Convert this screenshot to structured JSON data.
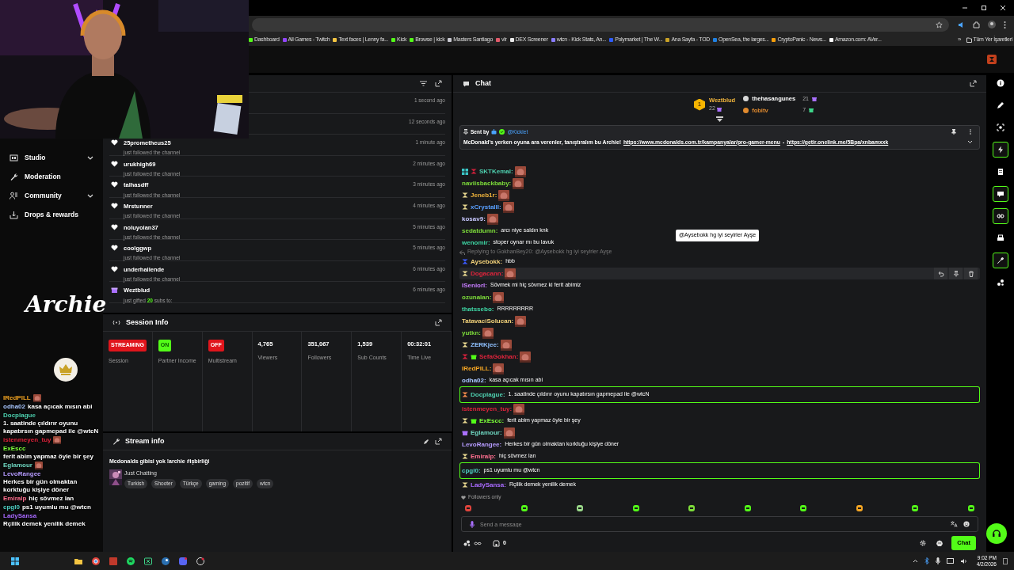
{
  "browser": {
    "bookmarks": [
      {
        "label": "Dashboard",
        "color": "#53fc18"
      },
      {
        "label": "All Games - Twitch",
        "color": "#9146ff"
      },
      {
        "label": "Text faces | Lenny fa...",
        "color": "#f5c542"
      },
      {
        "label": "Kick",
        "color": "#53fc18"
      },
      {
        "label": "Browse | kick",
        "color": "#53fc18"
      },
      {
        "label": "Masters Santiago",
        "color": "#c8c8d0"
      },
      {
        "label": "vlr",
        "color": "#e05a6a"
      },
      {
        "label": "DEX Screener",
        "color": "#e8e8e8"
      },
      {
        "label": "wtcn - Kick Stats, An...",
        "color": "#8a7dff"
      },
      {
        "label": "Polymarket | The W...",
        "color": "#2e5cff"
      },
      {
        "label": "Ana Sayfa - TOD",
        "color": "#c9a227"
      },
      {
        "label": "OpenSea, the larges...",
        "color": "#2081e2"
      },
      {
        "label": "CryptoPanic - News...",
        "color": "#f59e0b"
      },
      {
        "label": "Amazon.com: AVer...",
        "color": "#ffffff"
      }
    ],
    "more": "»",
    "all_bookmarks": "Tüm Yer İşaretleri"
  },
  "sidebar": {
    "items": [
      {
        "label": "Studio",
        "expandable": true
      },
      {
        "label": "Moderation",
        "expandable": false
      },
      {
        "label": "Community",
        "expandable": true
      },
      {
        "label": "Drops & rewards",
        "expandable": false
      }
    ]
  },
  "overlay": {
    "logo": "Archie",
    "chat": [
      {
        "user": "IRedPILL",
        "color": "#f5a623",
        "emote": true
      },
      {
        "user": "odha02",
        "color": "#a9c7ff",
        "text": "kasa açıcak mısın abi"
      },
      {
        "user": "Docplague",
        "color": "#4fd1b0",
        "text": "1. saatinde çıldırır oyunu kapatırsın gapmepad ile @wtcN"
      },
      {
        "user": "istenmeyen_tuy",
        "color": "#e0243c",
        "emote": true
      },
      {
        "user": "ExEscc",
        "color": "#7dff3a",
        "text": "ferit abim yapmaz öyle bir şey"
      },
      {
        "user": "Eglamour",
        "color": "#6fd6c0",
        "emote": true
      },
      {
        "user": "LevoRangee",
        "color": "#b69cff",
        "text": "Herkes bir gün olmaktan korktuğu kişiye döner"
      },
      {
        "user": "Emiralp",
        "color": "#ff6f8f",
        "text": "hiç sövmez lan"
      },
      {
        "user": "cpgl0",
        "color": "#4fd1c5",
        "text": "ps1 uyumlu mu @wtcn"
      },
      {
        "user": "LadySansa",
        "color": "#a96bff",
        "text": "Rçilik demek yenilik demek"
      }
    ]
  },
  "activity_feed": {
    "items": [
      {
        "kind": "hidden",
        "time": "1 second ago"
      },
      {
        "kind": "hidden",
        "time": "12 seconds ago"
      },
      {
        "kind": "follow",
        "user": "25prometheus25",
        "detail": "just followed the channel",
        "time": "1 minute ago"
      },
      {
        "kind": "follow",
        "user": "urukhigh69",
        "detail": "just followed the channel",
        "time": "2 minutes ago"
      },
      {
        "kind": "follow",
        "user": "talhasdff",
        "detail": "just followed the channel",
        "time": "3 minutes ago"
      },
      {
        "kind": "follow",
        "user": "Mrstunner",
        "detail": "just followed the channel",
        "time": "4 minutes ago"
      },
      {
        "kind": "follow",
        "user": "noluyolan37",
        "detail": "just followed the channel",
        "time": "5 minutes ago"
      },
      {
        "kind": "follow",
        "user": "coolggwp",
        "detail": "just followed the channel",
        "time": "5 minutes ago"
      },
      {
        "kind": "follow",
        "user": "underhallende",
        "detail": "just followed the channel",
        "time": "6 minutes ago"
      },
      {
        "kind": "gift",
        "user": "Weztblud",
        "detail": "just gifted",
        "gift_count": "20",
        "detail_end": "subs to:",
        "time": "6 minutes ago"
      }
    ]
  },
  "session_info": {
    "title": "Session Info",
    "stats": [
      {
        "kind": "badge",
        "value": "STREAMING",
        "color": "#e0151c",
        "label": "Session"
      },
      {
        "kind": "badge",
        "value": "ON",
        "color": "#53fc18",
        "label": "Partner Income"
      },
      {
        "kind": "badge",
        "value": "OFF",
        "color": "#e0151c",
        "label": "Multistream"
      },
      {
        "kind": "number",
        "value": "4,765",
        "label": "Viewers"
      },
      {
        "kind": "number",
        "value": "351,067",
        "label": "Followers"
      },
      {
        "kind": "number",
        "value": "1,539",
        "label": "Sub Counts"
      },
      {
        "kind": "number",
        "value": "00:32:01",
        "label": "Time Live"
      }
    ]
  },
  "stream_info": {
    "title": "Stream info",
    "stream_title": "Mcdonalds gibisi yok !archie #işbirliği",
    "category": "Just Chatting",
    "tags": [
      "Turkish",
      "Shooter",
      "Türkçe",
      "gaming",
      "pozitif",
      "wtcn"
    ]
  },
  "chat": {
    "title": "Chat",
    "leaderboard": [
      {
        "kind": "gold",
        "rank": "1",
        "user": "Weztblud",
        "count": "22"
      },
      {
        "kind": "silver",
        "user": "thehasangunes",
        "count": "21"
      },
      {
        "kind": "bronze",
        "user": "fobitv",
        "count": "7"
      }
    ],
    "pinned": {
      "label": "Sent by",
      "sender": "@Kicklet",
      "text": "McDonald's yerken oyuna ara verenler, tanıştıralım bu Archie!",
      "links": [
        "https://www.mcdonalds.com.tr/kampanyalar/pro-gamer-menu",
        "https://getir.onelink.me/5Bpa/xnbamxxk"
      ],
      "separator": "-"
    },
    "tooltip": "@Aysebokk hg iyi seyirler Ayşe",
    "messages": [
      {
        "user": "SKTKemal:",
        "color": "#4fd1b0",
        "badges": [
          {
            "kind": "grid",
            "color": "#3bc6c6"
          },
          {
            "kind": "sub",
            "color": "#d0213b"
          }
        ],
        "emote": true,
        "highlighted": false,
        "hovered": false
      },
      {
        "user": "naviisbackbaby:",
        "color": "#7ddc3a",
        "emote": true,
        "highlighted": false,
        "hovered": false
      },
      {
        "user": "Jeneb1r:",
        "color": "#f0b43c",
        "badges": [
          {
            "kind": "sub",
            "color": "#e8d890"
          }
        ],
        "emote": true,
        "highlighted": false,
        "hovered": false
      },
      {
        "user": "xCrystalll:",
        "color": "#5aa0ff",
        "badges": [
          {
            "kind": "sub",
            "color": "#e8d890"
          }
        ],
        "emote": true,
        "highlighted": false,
        "hovered": false
      },
      {
        "user": "kosav9:",
        "color": "#c8c8ff",
        "emote": true,
        "highlighted": false,
        "hovered": false
      },
      {
        "user": "sedatdumn:",
        "color": "#7ddc3a",
        "text": "arcı niye saldın knk",
        "highlighted": false,
        "hovered": false
      },
      {
        "user": "wenomir:",
        "color": "#3ed6a4",
        "text": "stoper oynar mı bu lavuk",
        "highlighted": false,
        "hovered": false
      },
      {
        "user": "Aysebokk:",
        "color": "#f3d27a",
        "reply": "Replying to GokhanBey20: @Aysebokk hg iyi seyirler Ayşe",
        "badges": [
          {
            "kind": "sub",
            "color": "#3b5bff"
          }
        ],
        "text": "hbb",
        "highlighted": false,
        "hovered": false
      },
      {
        "user": "Dogacann:",
        "color": "#e0243c",
        "badges": [
          {
            "kind": "sub",
            "color": "#e8d890"
          }
        ],
        "emote": true,
        "highlighted": false,
        "hovered": true
      },
      {
        "user": "ISeniorI:",
        "color": "#c77dff",
        "text": "Sövmek mi hiç sövmez ki ferit abimiz",
        "highlighted": false,
        "hovered": false
      },
      {
        "user": "ozunalan:",
        "color": "#7ddc3a",
        "emote": true,
        "highlighted": false,
        "hovered": false
      },
      {
        "user": "thatssebo:",
        "color": "#3ed6a4",
        "text": "RRRRRRRRR",
        "highlighted": false,
        "hovered": false
      },
      {
        "user": "TatavaciSolucan:",
        "color": "#f3d27a",
        "emote": true,
        "highlighted": false,
        "hovered": false
      },
      {
        "user": "yutkn:",
        "color": "#7ddc3a",
        "emote": true,
        "highlighted": false,
        "hovered": false
      },
      {
        "user": "ZERKjee:",
        "color": "#8fc1ff",
        "badges": [
          {
            "kind": "sub",
            "color": "#e8d890"
          }
        ],
        "emote": true,
        "highlighted": false,
        "hovered": false
      },
      {
        "user": "SefaGokhan:",
        "color": "#e0243c",
        "badges": [
          {
            "kind": "sub",
            "color": "#d0213b"
          },
          {
            "kind": "gift",
            "color": "#53fc18"
          }
        ],
        "emote": true,
        "highlighted": false,
        "hovered": false
      },
      {
        "user": "IRedPILL:",
        "color": "#f5a623",
        "emote": true,
        "highlighted": false,
        "hovered": false
      },
      {
        "user": "odha02:",
        "color": "#a9c7ff",
        "text": "kasa açıcak mısın abi",
        "highlighted": false,
        "hovered": false
      },
      {
        "user": "Docplague:",
        "color": "#4fd1b0",
        "badges": [
          {
            "kind": "sub",
            "color": "#f08a4b"
          }
        ],
        "text": "1. saatinde çıldırır oyunu kapatırsın gapmepad ile @wtcN",
        "highlighted": true,
        "hovered": false
      },
      {
        "user": "istenmeyen_tuy:",
        "color": "#e0243c",
        "emote": true,
        "highlighted": false,
        "hovered": false
      },
      {
        "user": "ExEscc:",
        "color": "#7dff3a",
        "badges": [
          {
            "kind": "sub",
            "color": "#e8d890"
          },
          {
            "kind": "gift",
            "color": "#53fc18"
          }
        ],
        "text": "ferit abim yapmaz öyle bir şey",
        "highlighted": false,
        "hovered": false
      },
      {
        "user": "Eglamour:",
        "color": "#6fd6c0",
        "badges": [
          {
            "kind": "gift",
            "color": "#a970ff"
          }
        ],
        "emote": true,
        "highlighted": false,
        "hovered": false
      },
      {
        "user": "LevoRangee:",
        "color": "#b69cff",
        "text": "Herkes bir gün olmaktan korktuğu kişiye döner",
        "highlighted": false,
        "hovered": false
      },
      {
        "user": "Emiralp:",
        "color": "#ff6f8f",
        "badges": [
          {
            "kind": "sub",
            "color": "#e8d890"
          }
        ],
        "text": "hiç sövmez lan",
        "highlighted": false,
        "hovered": false
      },
      {
        "user": "cpgl0:",
        "color": "#4fd1c5",
        "text": "ps1 uyumlu mu @wtcn",
        "highlighted": true,
        "hovered": false
      },
      {
        "user": "LadySansa:",
        "color": "#a96bff",
        "badges": [
          {
            "kind": "sub",
            "color": "#e8d890"
          }
        ],
        "text": "Rçilik demek yenilik demek",
        "highlighted": false,
        "hovered": false
      }
    ],
    "followers_only": "Followers only",
    "emote_bar": [
      {
        "color": "#e0443c"
      },
      {
        "color": "#53fc18"
      },
      {
        "color": "#9ad98a"
      },
      {
        "color": "#53fc18"
      },
      {
        "color": "#7ddc3a"
      },
      {
        "color": "#53fc18"
      },
      {
        "color": "#53fc18"
      },
      {
        "color": "#f5a623"
      },
      {
        "color": "#53fc18"
      },
      {
        "color": "#53fc18"
      }
    ],
    "input_placeholder": "Send a message",
    "store_count": "0",
    "send_button": "Chat"
  },
  "right_rail": [
    {
      "highlighted": false
    },
    {
      "highlighted": false
    },
    {
      "highlighted": false
    },
    {
      "highlighted": true
    },
    {
      "highlighted": false
    },
    {
      "highlighted": true
    },
    {
      "highlighted": true
    },
    {
      "highlighted": false
    },
    {
      "highlighted": true
    },
    {
      "highlighted": false
    }
  ],
  "taskbar": {
    "time": "9:02 PM",
    "date": "4/2/2026"
  }
}
